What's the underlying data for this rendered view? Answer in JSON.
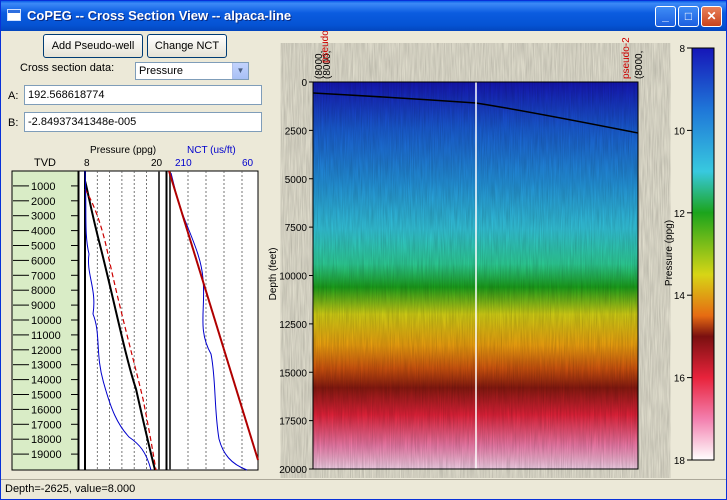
{
  "window": {
    "title": "CoPEG -- Cross Section View -- alpaca-line"
  },
  "toolbar": {
    "add_pseudo_well": "Add Pseudo-well",
    "change_nct": "Change NCT"
  },
  "cross_section": {
    "label": "Cross section data:",
    "selected": "Pressure"
  },
  "params": {
    "a_label": "A:",
    "a_value": "192.568618774",
    "b_label": "B:",
    "b_value": "-2.84937341348e-005"
  },
  "well_log": {
    "tvd_label": "TVD",
    "tvd_ticks": [
      "1000",
      "2000",
      "3000",
      "4000",
      "5000",
      "6000",
      "7000",
      "8000",
      "9000",
      "10000",
      "11000",
      "12000",
      "13000",
      "14000",
      "15000",
      "16000",
      "17000",
      "18000",
      "19000"
    ],
    "pressure_label": "Pressure (ppg)",
    "pressure_min": "8",
    "pressure_max": "20",
    "nct_label": "NCT (us/ft)",
    "nct_min": "210",
    "nct_max": "60",
    "colors": {
      "nct": "#0000cc",
      "pressure_curve": "#000000",
      "trend": "#cc0000",
      "nct_line": "#b00000"
    }
  },
  "section": {
    "y_axis_label": "Depth (feet)",
    "y_ticks": [
      "0",
      "2500",
      "5000",
      "7500",
      "10000",
      "12500",
      "15000",
      "17500",
      "20000"
    ],
    "well_1": {
      "name": "pseudo-1",
      "coord_a": "(8000,",
      "coord_b": "(8000,"
    },
    "well_2": {
      "name": "pseudo-2",
      "coord": "(8000,"
    }
  },
  "colorbar": {
    "label": "Pressure (ppg)",
    "ticks": [
      "8",
      "10",
      "12",
      "14",
      "16",
      "18"
    ]
  },
  "status": {
    "text": "Depth=-2625, value=8.000"
  }
}
